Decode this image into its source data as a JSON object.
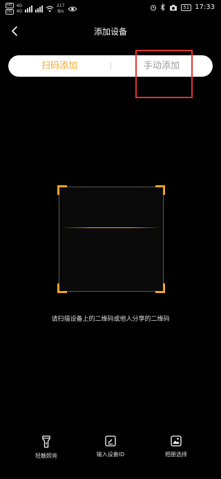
{
  "status_bar": {
    "hd_top": "HD",
    "hd_bottom": "HD",
    "net_top": "4G",
    "net_bottom": "4G",
    "speed_value": "217",
    "speed_unit": "B/s",
    "battery": "51",
    "time": "17:33"
  },
  "header": {
    "title": "添加设备"
  },
  "tabs": {
    "scan_label": "扫码添加",
    "manual_label": "手动添加",
    "active": "scan",
    "active_color": "#f5a623",
    "highlight_color": "#e5332f"
  },
  "scanner": {
    "hint": "请扫描设备上的二维码或他人分享的二维码",
    "frame_color": "#f5a623"
  },
  "toolbar": {
    "light_label": "轻触照亮",
    "input_label": "输入设备ID",
    "album_label": "相册选择"
  }
}
